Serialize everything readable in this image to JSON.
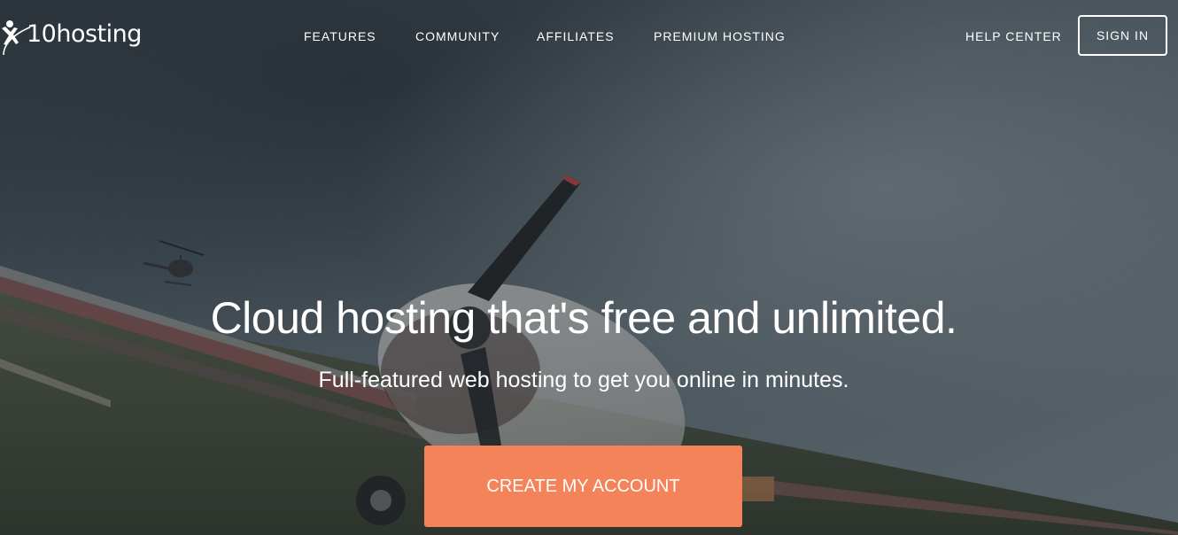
{
  "brand": {
    "name": "10hosting",
    "logo_icon": "person-swoosh-logo"
  },
  "nav": {
    "items": [
      {
        "label": "FEATURES"
      },
      {
        "label": "COMMUNITY"
      },
      {
        "label": "AFFILIATES"
      },
      {
        "label": "PREMIUM HOSTING"
      }
    ],
    "help_center": "HELP CENTER",
    "sign_in": "SIGN IN"
  },
  "hero": {
    "headline": "Cloud hosting that's free and unlimited.",
    "subheadline": "Full-featured web hosting to get you online in minutes.",
    "cta_label": "CREATE MY ACCOUNT",
    "background_image": "stormy-sky-airfield-propeller-plane-helicopter"
  },
  "colors": {
    "cta": "#f5835a",
    "text": "#ffffff",
    "overlay": "#3f4a52"
  }
}
